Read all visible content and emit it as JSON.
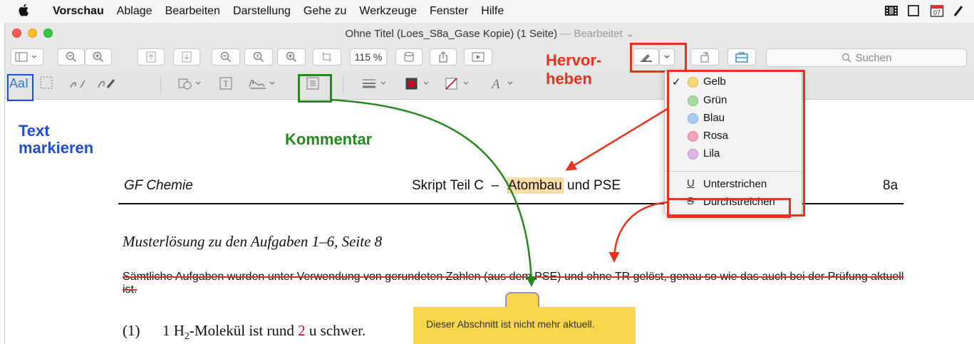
{
  "menubar": {
    "app_name": "Vorschau",
    "items": [
      "Ablage",
      "Bearbeiten",
      "Darstellung",
      "Gehe zu",
      "Werkzeuge",
      "Fenster",
      "Hilfe"
    ],
    "calendar_day": "07"
  },
  "window": {
    "title": "Ohne Titel (Loes_S8a_Gase Kopie) (1 Seite)",
    "title_sep": " — ",
    "edited": "Bearbeitet ⌄"
  },
  "toolbar": {
    "zoom": "115 %",
    "search_placeholder": "Suchen"
  },
  "markup": {
    "text_select_label": "AaI"
  },
  "highlight_menu": {
    "items": [
      {
        "label": "Gelb",
        "color": "#f7d874",
        "checked": true
      },
      {
        "label": "Grün",
        "color": "#a7dca0",
        "checked": false
      },
      {
        "label": "Blau",
        "color": "#a6cdf2",
        "checked": false
      },
      {
        "label": "Rosa",
        "color": "#f2a3b8",
        "checked": false
      },
      {
        "label": "Lila",
        "color": "#deb5e8",
        "checked": false
      }
    ],
    "check": "✓",
    "underline_label": "Unterstrichen",
    "underline_symbol": "U",
    "strike_label": "Durchstreichen",
    "strike_symbol": "S"
  },
  "annotations": {
    "text_select": "Text\nmarkieren",
    "comment": "Kommentar",
    "highlight": "Hervor-\nheben",
    "colors": {
      "blue": "#1f4fd1",
      "green": "#27871f",
      "red": "#e8321c"
    }
  },
  "document": {
    "header_left": "GF Chemie",
    "header_mid_before": "Skript Teil C  –  ",
    "header_mid_highlight": "Atombau",
    "header_mid_after": " und PSE",
    "header_right": "8a",
    "subtitle": "Musterlösung zu den Aufgaben 1–6, Seite 8",
    "struck_paragraph": "Sämtliche Aufgaben wurden unter Verwendung von gerundeten Zahlen (aus dem PSE) und ohne TR gelöst, genau so wie das auch bei der Prüfung aktuell ist.",
    "item_number": "(1)",
    "item_text_before": "1 H",
    "item_sub": "2",
    "item_text_mid": "-Molekül ist rund ",
    "item_value": "2",
    "item_text_after": " u schwer.",
    "note_text": "Dieser Abschnitt ist nicht mehr aktuell."
  }
}
